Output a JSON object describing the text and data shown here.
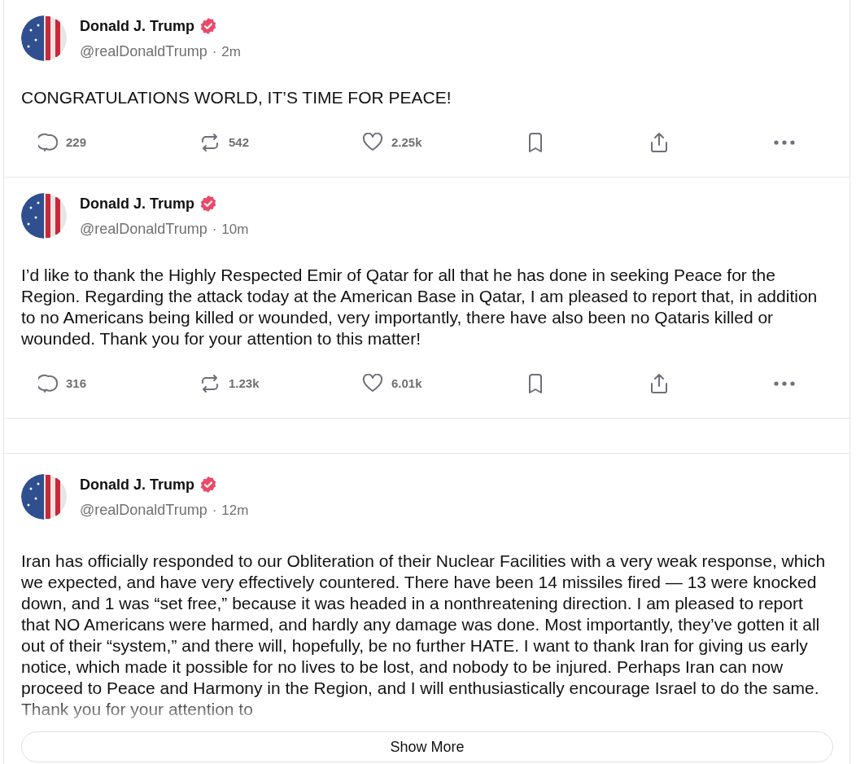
{
  "posts": [
    {
      "author": "Donald J. Trump",
      "verified": true,
      "handle": "@realDonaldTrump",
      "separator": "·",
      "time": "2m",
      "body": "CONGRATULATIONS WORLD, IT’S TIME FOR PEACE!",
      "stats": {
        "replies": "229",
        "reposts": "542",
        "likes": "2.25k"
      }
    },
    {
      "author": "Donald J. Trump",
      "verified": true,
      "handle": "@realDonaldTrump",
      "separator": "·",
      "time": "10m",
      "body": "I’d like to thank the Highly Respected Emir of Qatar for all that he has done in seeking Peace for the Region. Regarding the attack today at the American Base in Qatar, I am pleased to report that, in addition to no Americans being killed or wounded, very importantly, there have also been no Qataris killed or wounded. Thank you for your attention to this matter!",
      "stats": {
        "replies": "316",
        "reposts": "1.23k",
        "likes": "6.01k"
      }
    },
    {
      "author": "Donald J. Trump",
      "verified": true,
      "handle": "@realDonaldTrump",
      "separator": "·",
      "time": "12m",
      "body": "Iran has officially responded to our Obliteration of their Nuclear Facilities with a very weak response, which we expected, and have very effectively countered. There have been 14 missiles fired — 13 were knocked down, and 1 was “set free,” because it was headed in a nonthreatening direction. I am pleased to report that NO Americans were harmed, and hardly any damage was done. Most importantly, they’ve gotten it all out of their “system,” and there will, hopefully, be no further HATE. I want to thank Iran for giving us early notice, which made it possible for no lives to be lost, and nobody to be injured. Perhaps Iran can now proceed to Peace and Harmony in the Region, and I will enthusiastically encourage Israel to do the same. Thank you for your attention to",
      "show_more": "Show More"
    }
  ]
}
